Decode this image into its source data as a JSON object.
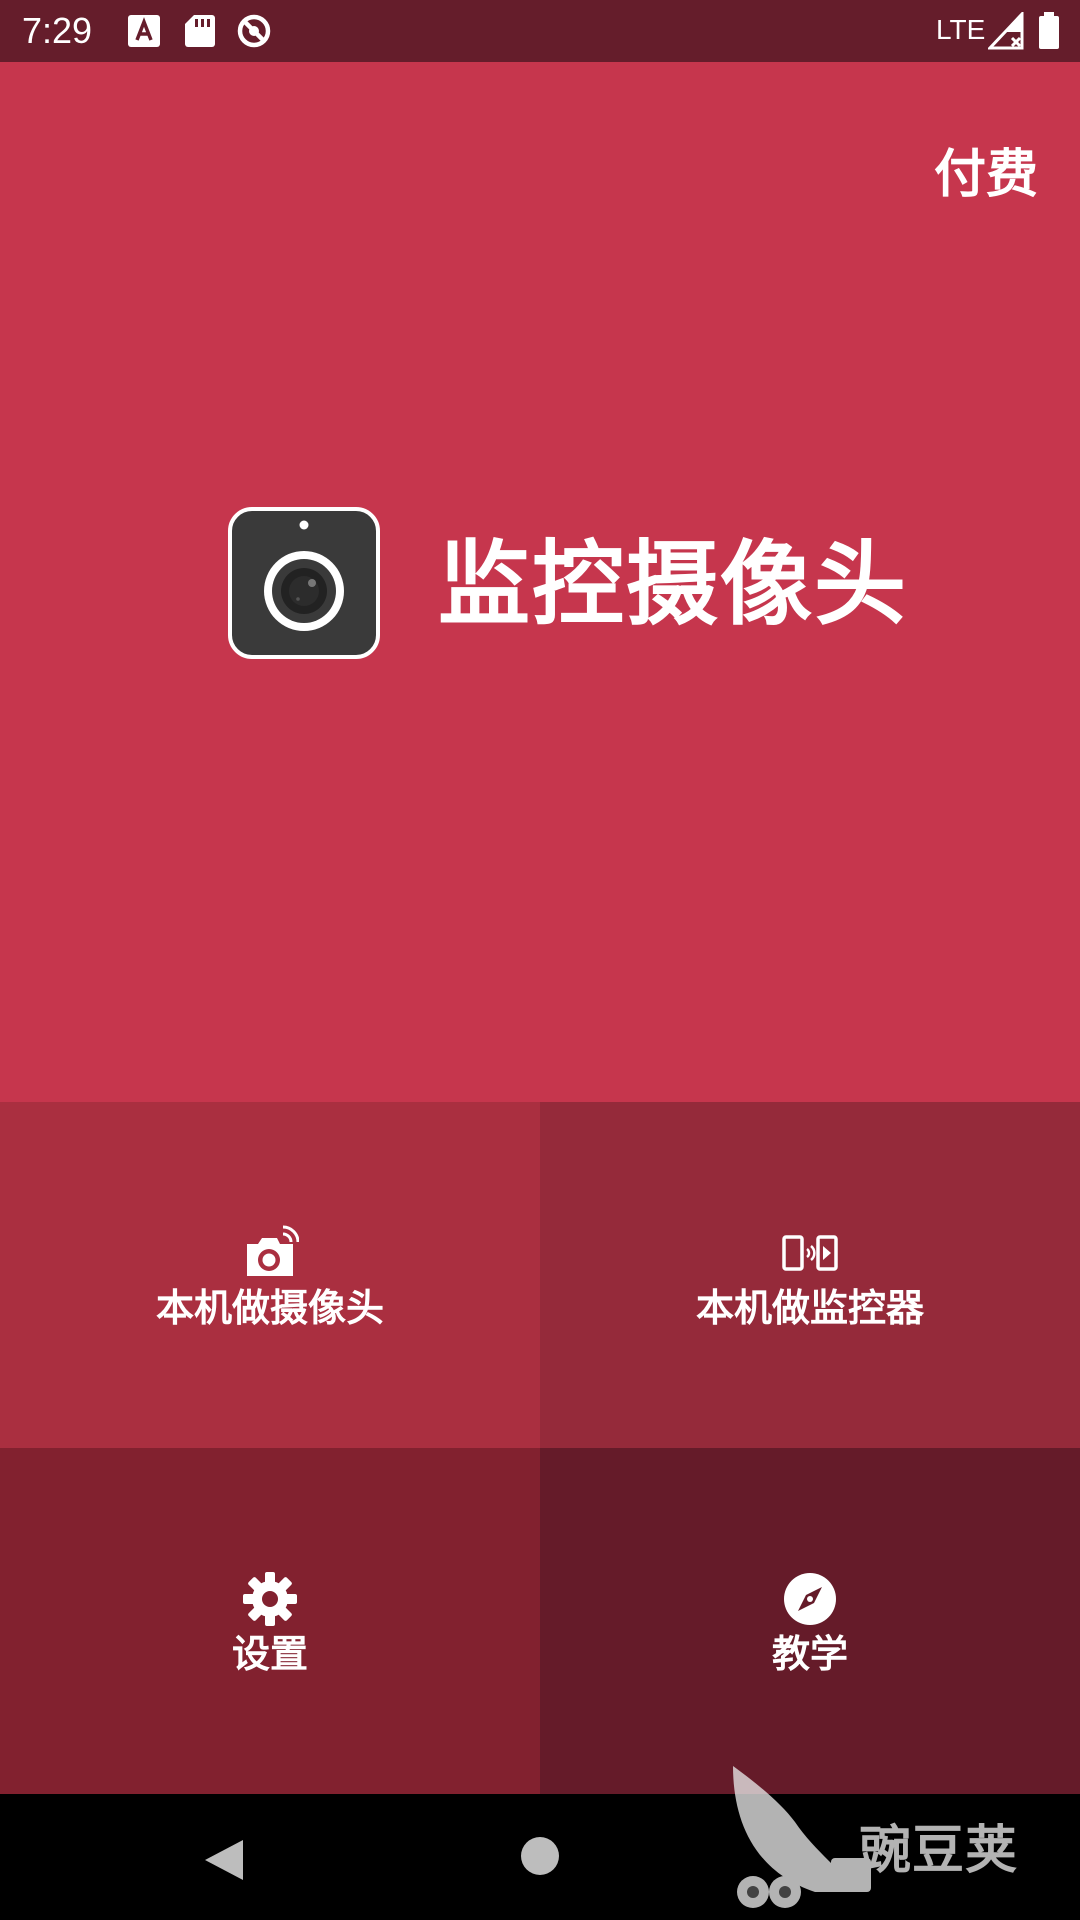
{
  "status_bar": {
    "time": "7:29",
    "network": "LTE",
    "icons": [
      "font-download-icon",
      "sd-card-icon",
      "no-entry-icon",
      "signal-off-icon",
      "battery-icon"
    ]
  },
  "header": {
    "pay_label": "付费"
  },
  "hero": {
    "app_title": "监控摄像头",
    "logo_icon": "camera-logo-icon"
  },
  "tiles": [
    {
      "label": "本机做摄像头",
      "icon": "camera-wifi-icon"
    },
    {
      "label": "本机做监控器",
      "icon": "devices-monitor-icon"
    },
    {
      "label": "设置",
      "icon": "gear-icon"
    },
    {
      "label": "教学",
      "icon": "compass-icon"
    }
  ],
  "nav_bar": {
    "buttons": [
      "back-icon",
      "home-icon"
    ]
  },
  "watermark": {
    "text": "豌豆荚"
  },
  "colors": {
    "status_bar": "#651d2b",
    "hero_bg": "#c6364d",
    "tile_1": "#aa2f40",
    "tile_2": "#952a3a",
    "tile_3": "#82212f",
    "tile_4": "#651b29",
    "nav_bar": "#000000"
  }
}
